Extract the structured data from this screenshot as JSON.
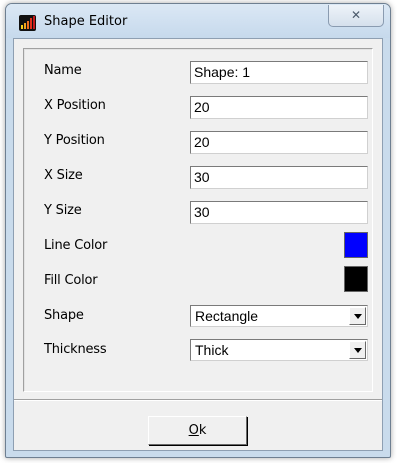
{
  "window": {
    "title": "Shape Editor",
    "close_glyph": "✕",
    "app_icon": "bar-chart-icon"
  },
  "form": {
    "name": {
      "label": "Name",
      "value": "Shape: 1"
    },
    "x_position": {
      "label": "X Position",
      "value": "20"
    },
    "y_position": {
      "label": "Y Position",
      "value": "20"
    },
    "x_size": {
      "label": "X Size",
      "value": "30"
    },
    "y_size": {
      "label": "Y Size",
      "value": "30"
    },
    "line_color": {
      "label": "Line Color",
      "color": "#0000ff"
    },
    "fill_color": {
      "label": "Fill Color",
      "color": "#000000"
    },
    "shape": {
      "label": "Shape",
      "selected": "Rectangle"
    },
    "thickness": {
      "label": "Thickness",
      "selected": "Thick"
    }
  },
  "footer": {
    "ok_mnemonic": "O",
    "ok_rest": "k"
  }
}
